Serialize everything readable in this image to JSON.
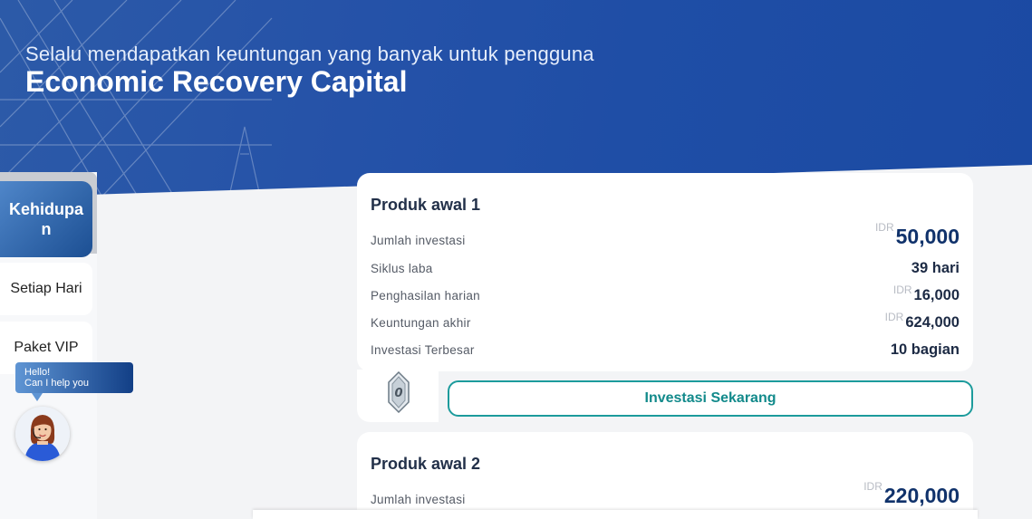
{
  "hero": {
    "subtitle": "Selalu mendapatkan keuntungan yang banyak untuk pengguna",
    "title": "Economic Recovery Capital"
  },
  "sidebar": {
    "active_label": "Kehidupan",
    "items": [
      {
        "label": "Setiap Hari"
      },
      {
        "label": "Paket VIP"
      }
    ]
  },
  "chat": {
    "line1": "Hello!",
    "line2": "Can I help you"
  },
  "products": [
    {
      "title": "Produk awal 1",
      "rows": [
        {
          "label": "Jumlah investasi",
          "currency": "IDR",
          "value": "50,000"
        },
        {
          "label": "Siklus laba",
          "currency": "",
          "value": "39 hari"
        },
        {
          "label": "Penghasilan harian",
          "currency": "IDR",
          "value": "16,000"
        },
        {
          "label": "Keuntungan akhir",
          "currency": "IDR",
          "value": "624,000"
        },
        {
          "label": "Investasi Terbesar",
          "currency": "",
          "value": "10 bagian"
        }
      ],
      "level": "0",
      "button_label": "Investasi Sekarang"
    },
    {
      "title": "Produk awal 2",
      "rows": [
        {
          "label": "Jumlah investasi",
          "currency": "IDR",
          "value": "220,000"
        }
      ]
    }
  ],
  "colors": {
    "hero_blue": "#2552a8",
    "accent_teal": "#1c9b9c",
    "value_navy": "#10326b"
  }
}
